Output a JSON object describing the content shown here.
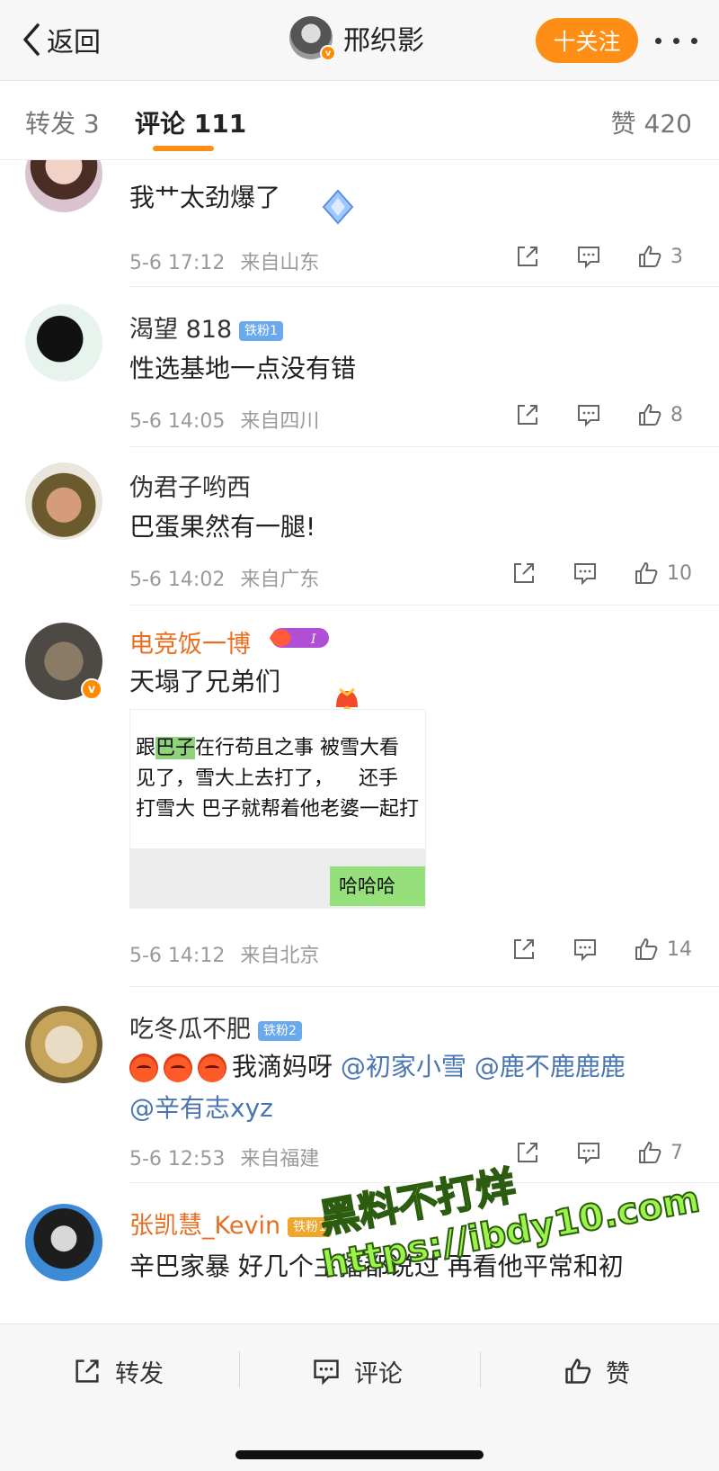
{
  "header": {
    "back_label": "返回",
    "profile_name": "邢织影",
    "follow_label": "十关注"
  },
  "tabs": {
    "repost": "转发 3",
    "comments": "评论 111",
    "likes": "赞 420"
  },
  "comments": [
    {
      "name": "",
      "text": "我艹太劲爆了",
      "time": "5-6 17:12",
      "location": "来自山东",
      "likes": "3"
    },
    {
      "name": "渴望 818",
      "badge": "铁粉1",
      "text": "性选基地一点没有错",
      "time": "5-6 14:05",
      "location": "来自四川",
      "likes": "8"
    },
    {
      "name": "伪君子哟西",
      "text": "巴蛋果然有一腿!",
      "time": "5-6 14:02",
      "location": "来自广东",
      "likes": "10"
    },
    {
      "name": "电竞饭一博",
      "text": "天塌了兄弟们",
      "time": "5-6 14:12",
      "location": "来自北京",
      "likes": "14",
      "image_lines": [
        "跟",
        "巴子",
        "在行苟且之事 被雪大看",
        "见了，雪大上去打了",
        "，",
        "还手",
        "打雪大 巴子就帮着他老婆一起打"
      ],
      "image_bubble": "哈哈哈"
    },
    {
      "name": "吃冬瓜不肥",
      "badge": "铁粉2",
      "text": "我滴妈呀",
      "mentions": [
        "@初家小雪",
        "@鹿不鹿鹿鹿",
        "@辛有志xyz"
      ],
      "time": "5-6 12:53",
      "location": "来自福建",
      "likes": "7"
    },
    {
      "name": "张凯慧_Kevin",
      "badge": "铁粉1",
      "text": "辛巴家暴 好几个主播都说过 再看他平常和初"
    }
  ],
  "watermark": {
    "line1": "黑料不打烊",
    "line2": "https://ibdy10.com"
  },
  "bottom_bar": {
    "repost": "转发",
    "comment": "评论",
    "like": "赞"
  },
  "colors": {
    "accent": "#ff8e16",
    "link": "#4a75b3",
    "username_orange": "#e86f1f",
    "watermark_green": "#9cf34a"
  }
}
